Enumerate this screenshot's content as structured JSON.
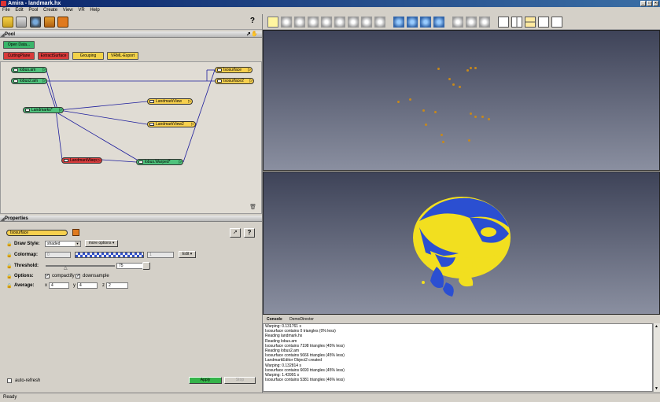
{
  "window": {
    "title": "Amira - landmark.hx",
    "min_label": "_",
    "max_label": "□",
    "close_label": "×"
  },
  "menu": [
    "File",
    "Edit",
    "Pool",
    "Create",
    "View",
    "VR",
    "Help"
  ],
  "left_toolbar": {
    "help_label": "?"
  },
  "pool": {
    "header": "Pool",
    "buttons": {
      "open_data": "Open Data...",
      "cutting_plane": "CuttingPlane",
      "extract_surface": "ExtractSurface",
      "grouping": "Grouping",
      "vrml_export": "VRML-Export"
    },
    "nodes": {
      "lobus": "lobus.am",
      "lobus2": "lobus2.am",
      "landmarks": "Landmarks*",
      "landmarkwarp": "LandmarkWarp",
      "lobus_warped": "lobus.Warped*",
      "landmarkview": "LandmarkView",
      "landmarkview2": "LandmarkView2",
      "isosurface": "Isosurface",
      "isosurface2": "Isosurface2"
    }
  },
  "properties": {
    "header": "Properties",
    "module_name": "Isosurface",
    "help_label": "?",
    "draw_style": {
      "label": "Draw Style:",
      "value": "shaded",
      "more": "more options"
    },
    "colormap": {
      "label": "Colormap:",
      "min": "0",
      "max": "1",
      "edit": "Edit"
    },
    "threshold": {
      "label": "Threshold:",
      "value": "75"
    },
    "options": {
      "label": "Options:",
      "opt1": "compactify",
      "opt2": "downsample"
    },
    "average": {
      "label": "Average:",
      "x_label": "x",
      "x": "4",
      "y_label": "y",
      "y": "4",
      "z_label": "z",
      "z": "2"
    },
    "auto_refresh": "auto-refresh",
    "apply": "Apply",
    "stop": "Stop"
  },
  "console": {
    "tabs": [
      "Console",
      "DemoDirector"
    ],
    "lines": [
      "Warping: 0.131761 s",
      "Isosurface contains 0 triangles (0% less)",
      "Reading landmark.hx",
      "Reading lobus.am",
      "Isosurface contains 7198 triangles (45% less)",
      "Reading lobus2.am",
      "Isosurface contains 5666 triangles (45% less)",
      "LandmarkEditor Object2 created",
      "Warping: 0.132814 s",
      "Isosurface contains 6693 triangles (45% less)",
      "Warping: 1.43991 s",
      "Isosurface contains 5381 triangles (46% less)"
    ]
  },
  "status": "Ready",
  "colors": {
    "green_node": "#4fc27c",
    "yellow_node": "#f7d04e",
    "red_node": "#d93c3c",
    "surface_blue": "#2b4fd1",
    "surface_yellow": "#f2df1f"
  }
}
